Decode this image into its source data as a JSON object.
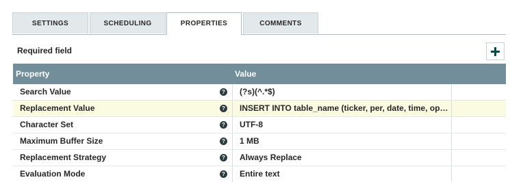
{
  "tabs": {
    "settings": "SETTINGS",
    "scheduling": "SCHEDULING",
    "properties": "PROPERTIES",
    "comments": "COMMENTS",
    "active": "PROPERTIES"
  },
  "required_label": "Required field",
  "add_button_icon": "plus-icon",
  "table": {
    "header_color": "#728e9b",
    "columns": {
      "property": "Property",
      "value": "Value"
    },
    "rows": [
      {
        "name": "Search Value",
        "value": "(?s)(^.*$)",
        "help_icon": "question-icon"
      },
      {
        "name": "Replacement Value",
        "value": "INSERT INTO table_name (ticker, per, date, time, open,...",
        "help_icon": "question-icon"
      },
      {
        "name": "Character Set",
        "value": "UTF-8",
        "help_icon": "question-icon"
      },
      {
        "name": "Maximum Buffer Size",
        "value": "1 MB",
        "help_icon": "question-icon"
      },
      {
        "name": "Replacement Strategy",
        "value": "Always Replace",
        "help_icon": "question-icon"
      },
      {
        "name": "Evaluation Mode",
        "value": "Entire text",
        "help_icon": "question-icon"
      }
    ]
  }
}
